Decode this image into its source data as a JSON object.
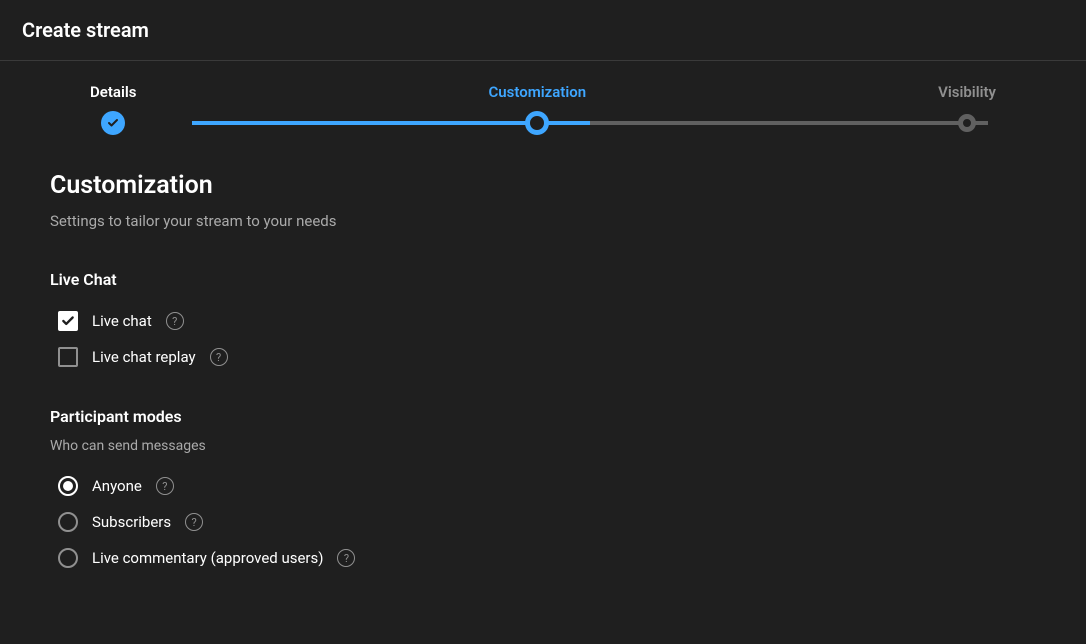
{
  "header": {
    "title": "Create stream"
  },
  "stepper": {
    "steps": [
      {
        "label": "Details",
        "state": "done"
      },
      {
        "label": "Customization",
        "state": "active"
      },
      {
        "label": "Visibility",
        "state": "pending"
      }
    ]
  },
  "section": {
    "title": "Customization",
    "subtitle": "Settings to tailor your stream to your needs"
  },
  "liveChat": {
    "title": "Live Chat",
    "options": [
      {
        "label": "Live chat",
        "checked": true
      },
      {
        "label": "Live chat replay",
        "checked": false
      }
    ]
  },
  "participantModes": {
    "title": "Participant modes",
    "subtitle": "Who can send messages",
    "options": [
      {
        "label": "Anyone",
        "selected": true
      },
      {
        "label": "Subscribers",
        "selected": false
      },
      {
        "label": "Live commentary (approved users)",
        "selected": false
      }
    ]
  }
}
